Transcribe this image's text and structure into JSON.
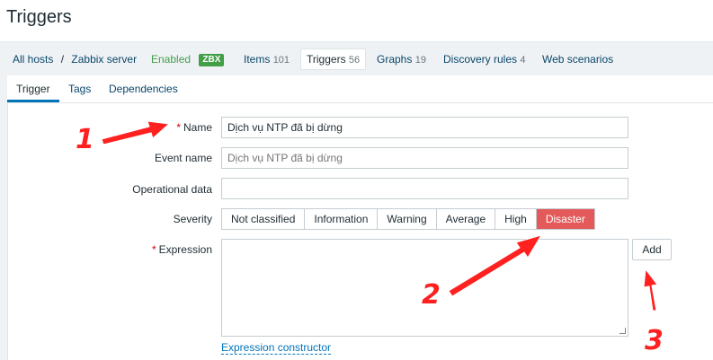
{
  "page": {
    "title": "Triggers"
  },
  "hostnav": {
    "all_hosts": "All hosts",
    "separator": "/",
    "host": "Zabbix server",
    "status": "Enabled",
    "agent_badge": "ZBX",
    "items": {
      "label": "Items",
      "count": "101"
    },
    "triggers": {
      "label": "Triggers",
      "count": "56"
    },
    "graphs": {
      "label": "Graphs",
      "count": "19"
    },
    "discovery": {
      "label": "Discovery rules",
      "count": "4"
    },
    "web": {
      "label": "Web scenarios"
    }
  },
  "tabs": {
    "trigger": "Trigger",
    "tags": "Tags",
    "dependencies": "Dependencies"
  },
  "form": {
    "required_mark": "*",
    "name": {
      "label": "Name",
      "value": "Dịch vụ NTP đã bị dừng"
    },
    "event_name": {
      "label": "Event name",
      "placeholder": "Dịch vụ NTP đã bị dừng"
    },
    "operational_data": {
      "label": "Operational data",
      "value": ""
    },
    "severity": {
      "label": "Severity",
      "options": [
        "Not classified",
        "Information",
        "Warning",
        "Average",
        "High",
        "Disaster"
      ],
      "selected": "Disaster",
      "selected_color": "#e45959"
    },
    "expression": {
      "label": "Expression",
      "value": "",
      "add_button": "Add"
    },
    "expression_constructor": "Expression constructor"
  },
  "annotations": {
    "color": "#ff2020",
    "marker_1": "1",
    "marker_2": "2",
    "marker_3": "3"
  }
}
